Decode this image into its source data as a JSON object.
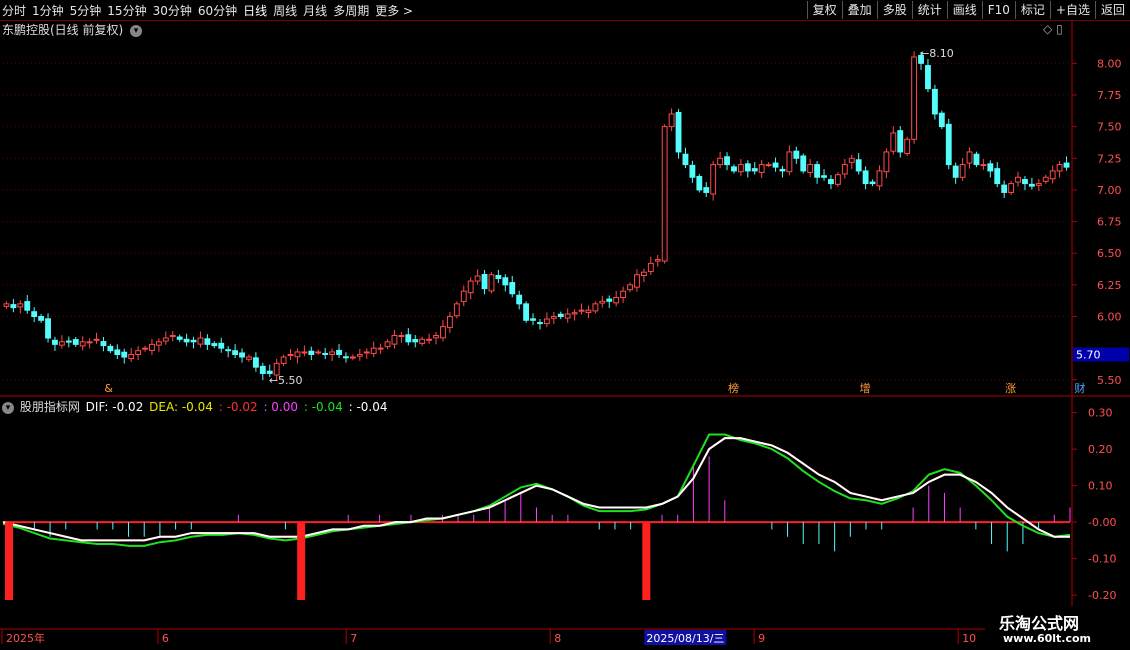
{
  "toolbar": {
    "periods": [
      "分时",
      "1分钟",
      "5分钟",
      "15分钟",
      "30分钟",
      "60分钟",
      "日线",
      "周线",
      "月线",
      "多周期",
      "更多 >"
    ],
    "active": "日线",
    "right": [
      "复权",
      "叠加",
      "多股",
      "统计",
      "画线",
      "F10",
      "标记",
      "+自选",
      "返回"
    ]
  },
  "stock_title": "东鹏控股(日线 前复权)",
  "indicator": {
    "name": "股朋指标网",
    "dif": "DIF: -0.02",
    "dea": "DEA: -0.04",
    "v1": ": -0.02",
    "v2": ": 0.00",
    "v3": ": -0.04",
    "v4": ": -0.04"
  },
  "colors": {
    "up": "#ff4a4a",
    "down": "#54fcfc",
    "axis": "#b00000",
    "dif": "#ffffff",
    "dea": "#e8e800",
    "red": "#ff2020",
    "green": "#20e020",
    "magenta": "#ff40ff"
  },
  "watermark": {
    "line1": "乐淘公式网",
    "line2": "www.60lt.com"
  },
  "chart_data": {
    "type": "candlestick",
    "price_axis": {
      "ylim": [
        5.38,
        8.2
      ],
      "ticks": [
        "8.00",
        "7.75",
        "7.50",
        "7.25",
        "7.00",
        "6.75",
        "6.50",
        "6.25",
        "6.00",
        "5.70",
        "5.50"
      ]
    },
    "current_price": "5.70",
    "annotations": [
      {
        "label": "8.10",
        "kind": "high"
      },
      {
        "label": "5.50",
        "kind": "low"
      }
    ],
    "event_markers": [
      {
        "index": 15,
        "label": "&"
      },
      {
        "index": 105,
        "label": "榜"
      },
      {
        "index": 124,
        "label": "增"
      },
      {
        "index": 145,
        "label": "涨"
      },
      {
        "index": 155,
        "label": "财"
      }
    ],
    "date_axis": [
      {
        "index": 0,
        "label": "2025年"
      },
      {
        "index": 23,
        "label": "6"
      },
      {
        "index": 50,
        "label": "7"
      },
      {
        "index": 80,
        "label": "8"
      },
      {
        "index": 93,
        "label": "2025/08/13/三"
      },
      {
        "index": 109,
        "label": "9"
      },
      {
        "index": 138,
        "label": "10"
      }
    ],
    "candles_close": [
      6.1,
      6.07,
      6.1,
      6.05,
      6.0,
      5.97,
      5.83,
      5.78,
      5.8,
      5.8,
      5.78,
      5.8,
      5.8,
      5.82,
      5.77,
      5.73,
      5.7,
      5.68,
      5.7,
      5.73,
      5.75,
      5.78,
      5.8,
      5.83,
      5.85,
      5.82,
      5.8,
      5.8,
      5.83,
      5.78,
      5.77,
      5.75,
      5.73,
      5.7,
      5.68,
      5.68,
      5.6,
      5.55,
      5.55,
      5.63,
      5.68,
      5.7,
      5.72,
      5.72,
      5.7,
      5.72,
      5.7,
      5.72,
      5.7,
      5.68,
      5.68,
      5.7,
      5.72,
      5.75,
      5.75,
      5.8,
      5.85,
      5.85,
      5.8,
      5.8,
      5.82,
      5.82,
      5.85,
      5.92,
      6.0,
      6.1,
      6.2,
      6.28,
      6.32,
      6.22,
      6.33,
      6.3,
      6.25,
      6.18,
      6.1,
      5.97,
      5.97,
      5.95,
      5.98,
      6.0,
      6.0,
      6.02,
      6.03,
      6.05,
      6.05,
      6.1,
      6.12,
      6.12,
      6.15,
      6.2,
      6.25,
      6.33,
      6.35,
      6.42,
      6.45,
      7.5,
      7.6,
      7.3,
      7.2,
      7.1,
      7.0,
      6.98,
      7.2,
      7.25,
      7.2,
      7.15,
      7.2,
      7.15,
      7.15,
      7.2,
      7.2,
      7.18,
      7.15,
      7.3,
      7.25,
      7.15,
      7.2,
      7.1,
      7.1,
      7.05,
      7.12,
      7.2,
      7.25,
      7.15,
      7.05,
      7.05,
      7.15,
      7.3,
      7.45,
      7.3,
      7.4,
      8.05,
      8.0,
      7.8,
      7.6,
      7.5,
      7.2,
      7.1,
      7.2,
      7.3,
      7.2,
      7.2,
      7.15,
      7.05,
      6.98,
      7.05,
      7.1,
      7.05,
      7.03,
      7.05,
      7.1,
      7.15,
      7.2,
      7.18
    ],
    "macd": {
      "ylim": [
        -0.29,
        0.34
      ],
      "ticks": [
        "0.30",
        "0.20",
        "0.10",
        "-0.00",
        "-0.10",
        "-0.20"
      ],
      "dif": [
        0,
        -0.01,
        -0.03,
        -0.05,
        -0.05,
        -0.05,
        -0.06,
        -0.06,
        -0.07,
        -0.07,
        -0.06,
        -0.05,
        -0.04,
        -0.03,
        -0.03,
        -0.02,
        -0.03,
        -0.04,
        -0.05,
        -0.04,
        -0.03,
        -0.02,
        -0.01,
        -0.01,
        0,
        0,
        0.01,
        0.01,
        0.02,
        0.03,
        0.04,
        0.06,
        0.09,
        0.12,
        0.12,
        0.1,
        0.08,
        0.05,
        0.03,
        0.03,
        0.03,
        0.04,
        0.06,
        0.08,
        0.2,
        0.29,
        0.26,
        0.23,
        0.22,
        0.2,
        0.17,
        0.13,
        0.1,
        0.07,
        0.06,
        0.06,
        0.05,
        0.07,
        0.1,
        0.16,
        0.17,
        0.15,
        0.1,
        0.05,
        0.0,
        -0.02,
        -0.03,
        -0.03,
        -0.02
      ],
      "dea": [
        0,
        -0.01,
        -0.02,
        -0.03,
        -0.04,
        -0.05,
        -0.05,
        -0.05,
        -0.05,
        -0.05,
        -0.04,
        -0.04,
        -0.03,
        -0.03,
        -0.03,
        -0.03,
        -0.03,
        -0.04,
        -0.04,
        -0.04,
        -0.03,
        -0.02,
        -0.02,
        -0.01,
        -0.01,
        0,
        0,
        0.01,
        0.01,
        0.02,
        0.03,
        0.04,
        0.06,
        0.08,
        0.1,
        0.09,
        0.07,
        0.05,
        0.04,
        0.04,
        0.04,
        0.04,
        0.05,
        0.07,
        0.12,
        0.2,
        0.23,
        0.23,
        0.22,
        0.21,
        0.19,
        0.16,
        0.13,
        0.11,
        0.08,
        0.07,
        0.06,
        0.07,
        0.08,
        0.11,
        0.13,
        0.13,
        0.11,
        0.08,
        0.04,
        0.01,
        -0.02,
        -0.04,
        -0.04
      ],
      "red_bar_indices": [
        0,
        19,
        41,
        85,
        126,
        151
      ]
    }
  }
}
